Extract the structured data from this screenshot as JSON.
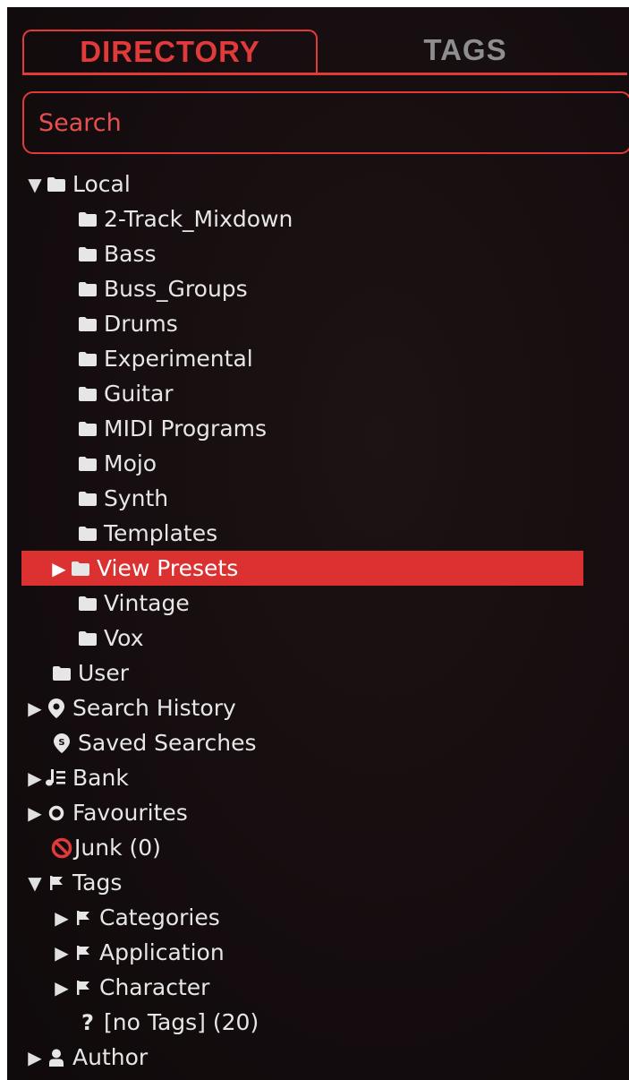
{
  "tabs": {
    "directory": "DIRECTORY",
    "tags": "TAGS"
  },
  "search": {
    "placeholder": "Search"
  },
  "colors": {
    "accent": "#e03a3a",
    "selected_bg": "#dc3131",
    "background": "#150d0f"
  },
  "tree": {
    "local": {
      "label": "Local",
      "children": [
        "2-Track_Mixdown",
        "Bass",
        "Buss_Groups",
        "Drums",
        "Experimental",
        "Guitar",
        "MIDI Programs",
        "Mojo",
        "Synth",
        "Templates",
        "View Presets",
        "Vintage",
        "Vox"
      ]
    },
    "user": "User",
    "search_history": "Search History",
    "saved_searches": "Saved Searches",
    "bank": "Bank",
    "favourites": "Favourites",
    "junk": "Junk (0)",
    "tags": {
      "label": "Tags",
      "children": [
        "Categories",
        "Application",
        "Character",
        "[no Tags] (20)"
      ]
    },
    "author": "Author"
  },
  "icons": {
    "folder": "folder-icon",
    "pin": "location-pin-icon",
    "saved": "saved-search-icon",
    "bank": "bank-icon",
    "favourite": "circle-icon",
    "junk": "prohibited-icon",
    "tag": "flag-icon",
    "unknown": "question-mark-icon",
    "author": "person-icon"
  }
}
